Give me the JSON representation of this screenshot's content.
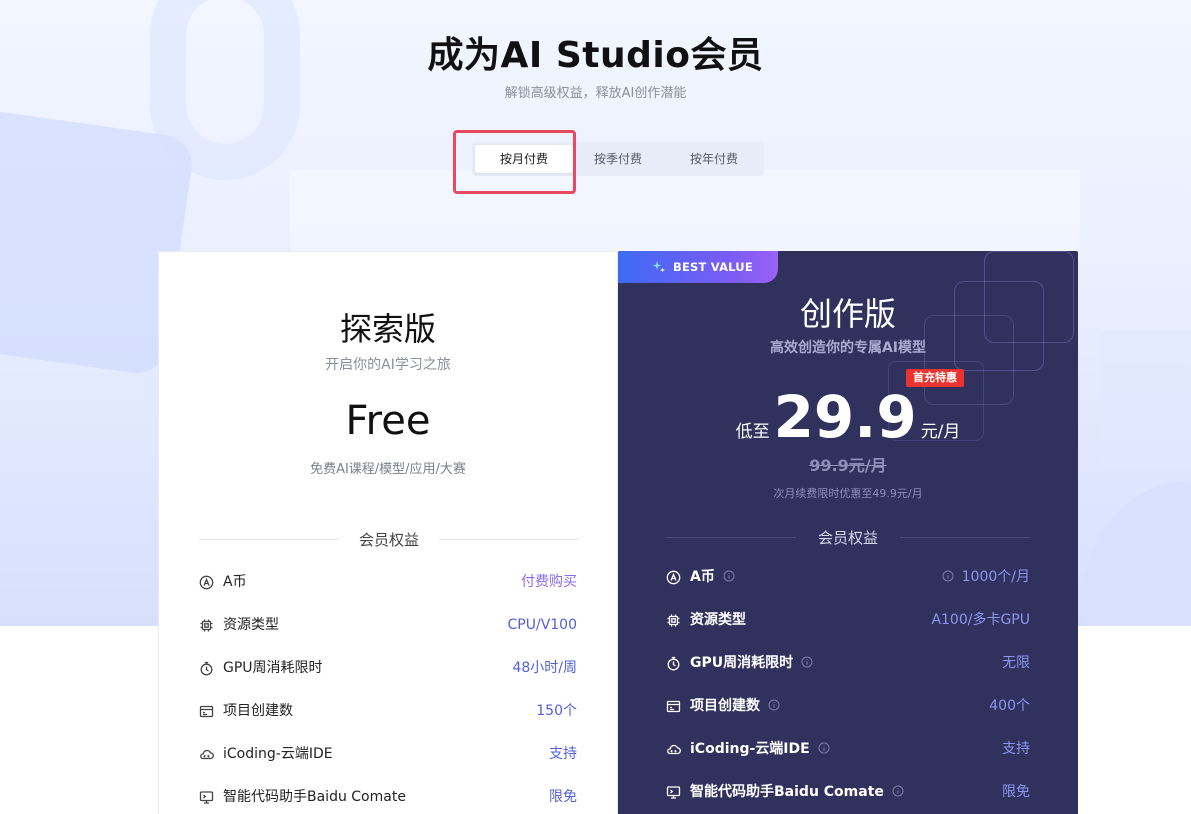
{
  "header": {
    "title": "成为AI Studio会员",
    "subtitle": "解锁高级权益，释放AI创作潜能"
  },
  "billing_tabs": [
    {
      "label": "按月付费",
      "active": true
    },
    {
      "label": "按季付费",
      "active": false
    },
    {
      "label": "按年付费",
      "active": false
    }
  ],
  "highlight_color": "#e84a5f",
  "plans": {
    "free": {
      "title": "探索版",
      "desc": "开启你的AI学习之旅",
      "price": "Free",
      "includes": "免费AI课程/模型/应用/大赛",
      "benefits_heading": "会员权益",
      "benefits": [
        {
          "icon": "coin-icon",
          "label": "A币",
          "value": "付费购买"
        },
        {
          "icon": "chip-icon",
          "label": "资源类型",
          "value": "CPU/V100"
        },
        {
          "icon": "stopwatch-icon",
          "label": "GPU周消耗限时",
          "value": "48小时/周"
        },
        {
          "icon": "project-icon",
          "label": "项目创建数",
          "value": "150个"
        },
        {
          "icon": "cloud-icon",
          "label": "iCoding-云端IDE",
          "value": "支持"
        },
        {
          "icon": "monitor-icon",
          "label": "智能代码助手Baidu Comate",
          "value": "限免"
        }
      ]
    },
    "pro": {
      "badge": "BEST VALUE",
      "title": "创作版",
      "desc": "高效创造你的专属AI模型",
      "promo_tag": "首充特惠",
      "price_prefix": "低至",
      "price": "29.9",
      "price_unit": "元/月",
      "original_price": "99.9元/月",
      "renew_note": "次月续费限时优惠至49.9元/月",
      "benefits_heading": "会员权益",
      "benefits": [
        {
          "icon": "coin-icon",
          "label": "A币",
          "value": "1000个/月"
        },
        {
          "icon": "chip-icon",
          "label": "资源类型",
          "value": "A100/多卡GPU"
        },
        {
          "icon": "stopwatch-icon",
          "label": "GPU周消耗限时",
          "value": "无限"
        },
        {
          "icon": "project-icon",
          "label": "项目创建数",
          "value": "400个"
        },
        {
          "icon": "cloud-icon",
          "label": "iCoding-云端IDE",
          "value": "支持"
        },
        {
          "icon": "monitor-icon",
          "label": "智能代码助手Baidu Comate",
          "value": "限免"
        }
      ]
    }
  },
  "colors": {
    "pro_card_bg": "#31315e",
    "accent_blue": "#5360d9",
    "promo_red": "#e8332f"
  }
}
